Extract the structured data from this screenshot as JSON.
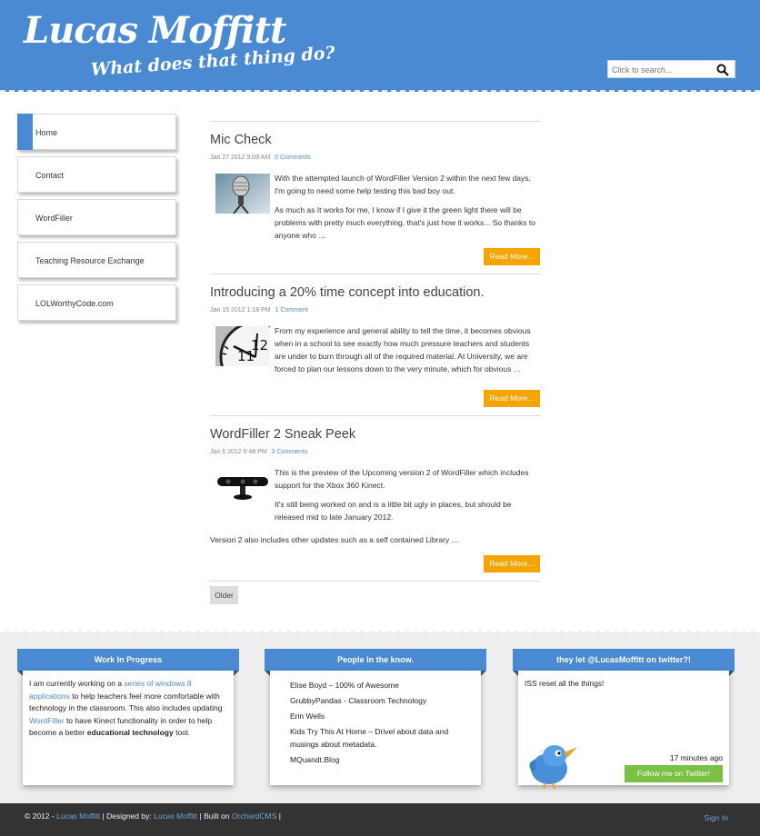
{
  "header": {
    "title": "Lucas Moffitt",
    "tagline": "What does that thing do?",
    "search_placeholder": "Click to search..."
  },
  "sidebar": {
    "items": [
      {
        "label": "Home",
        "active": true
      },
      {
        "label": "Contact"
      },
      {
        "label": "WordFiller"
      },
      {
        "label": "Teaching Resource Exchange"
      },
      {
        "label": "LOLWorthyCode.com"
      }
    ]
  },
  "posts": [
    {
      "title": "Mic Check",
      "date": "Jan 27 2012 9:09 AM",
      "comments": "0 Comments",
      "thumb_icon": "microphone-image",
      "paragraphs": [
        "With the attempted launch of WordFiller Version 2 within the next few days, I'm going to need some help testing this bad boy out.",
        "As much as It works for me, I know if I give it the green light there will be problems with pretty much everything, that's just how it works... So thanks to anyone who …"
      ],
      "read_more": "Read More..."
    },
    {
      "title": "Introducing a 20% time concept into education.",
      "date": "Jan 15 2012 1:18 PM",
      "comments": "1 Comment",
      "thumb_icon": "clock-image",
      "paragraphs": [
        "From my experience and general ability to tell the time, it becomes obvious when in a school to see exactly how much pressure teachers and students are under to burn through all of the required material. At University, we are forced to plan our lessons down to the very minute, which for obvious …"
      ],
      "read_more": "Read More..."
    },
    {
      "title": "WordFiller 2 Sneak Peek",
      "date": "Jan 6 2012 6:48 PM",
      "comments": "3 Comments",
      "thumb_icon": "kinect-image",
      "paragraphs": [
        "This is the preview of the Upcoming version 2 of WordFiller which includes support for the Xbox 360 Kinect.",
        "It's still being worked on and is a little bit ugly in places, but should be released mid to late January 2012."
      ],
      "extra": "Version 2 also includes other updates such as a self contained Library …",
      "read_more": "Read More..."
    }
  ],
  "older_label": "Older",
  "widgets": {
    "wip": {
      "title": "Work In Progress",
      "t1": "I am currently working on a ",
      "link1": "series of windows 8 applications",
      "t2": " to help teachers feel more comfortable with technology in the classroom. This also includes updating ",
      "link2": "WordFiller",
      "t3": " to have Kinect functionality in order to help become a better ",
      "bold": "educational technology",
      "t4": " tool."
    },
    "people": {
      "title": "People In the know.",
      "items": [
        "Elise Boyd – 100% of Awesome",
        "GrubbyPandas - Classroom Technology",
        "Erin Wells",
        "Kids Try This At Home – Drivel about data and musings about metadata.",
        "MQuandt.Blog"
      ]
    },
    "twitter": {
      "title": "they let @LucasMoffitt on twitter?!",
      "tweet": "ISS reset all the things!",
      "time": "17 minutes ago",
      "follow": "Follow me on Twitter!"
    }
  },
  "footer": {
    "copy": "© 2012 -",
    "author": "Lucas Moffitt",
    "designed_label": "| Designed by:",
    "designer": "Lucas Moffitt",
    "built_label": "| Built on",
    "platform": "OrchardCMS",
    "sep": "|",
    "signin": "Sign In"
  }
}
